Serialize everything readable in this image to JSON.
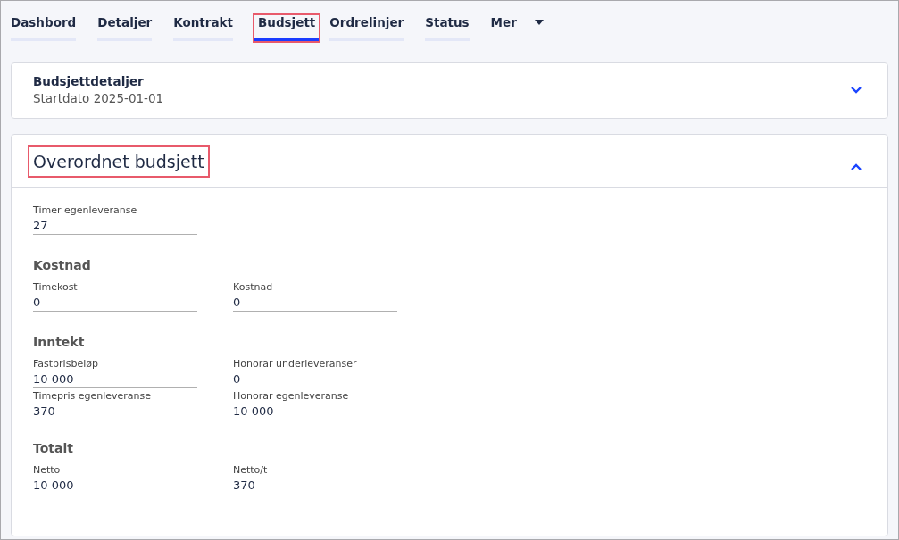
{
  "tabs": [
    {
      "label": "Dashbord",
      "selected": false,
      "highlighted": false
    },
    {
      "label": "Detaljer",
      "selected": false,
      "highlighted": false
    },
    {
      "label": "Kontrakt",
      "selected": false,
      "highlighted": false
    },
    {
      "label": "Budsjett",
      "selected": true,
      "highlighted": true
    },
    {
      "label": "Ordrelinjer",
      "selected": false,
      "highlighted": false
    },
    {
      "label": "Status",
      "selected": false,
      "highlighted": false
    }
  ],
  "more_menu": {
    "label": "Mer"
  },
  "details_panel": {
    "title": "Budsjettdetaljer",
    "subtitle": "Startdato 2025-01-01",
    "expanded": false
  },
  "budget_panel": {
    "title": "Overordnet budsjett",
    "highlighted": true,
    "expanded": true,
    "top_fields": [
      {
        "label": "Timer egenleveranse",
        "value": "27",
        "kind": "input"
      }
    ],
    "sections": [
      {
        "heading": "Kostnad",
        "fields": [
          {
            "label": "Timekost",
            "value": "0",
            "kind": "input"
          },
          {
            "label": "Kostnad",
            "value": "0",
            "kind": "input"
          }
        ]
      },
      {
        "heading": "Inntekt",
        "fields": [
          {
            "label": "Fastprisbeløp",
            "value": "10 000",
            "kind": "input"
          },
          {
            "label": "Honorar underleveranser",
            "value": "0",
            "kind": "readonly"
          },
          {
            "label": "Timepris egenleveranse",
            "value": "370",
            "kind": "readonly"
          },
          {
            "label": "Honorar egenleveranse",
            "value": "10 000",
            "kind": "readonly"
          }
        ]
      },
      {
        "heading": "Totalt",
        "fields": [
          {
            "label": "Netto",
            "value": "10 000",
            "kind": "readonly"
          },
          {
            "label": "Netto/t",
            "value": "370",
            "kind": "readonly"
          }
        ]
      }
    ]
  }
}
